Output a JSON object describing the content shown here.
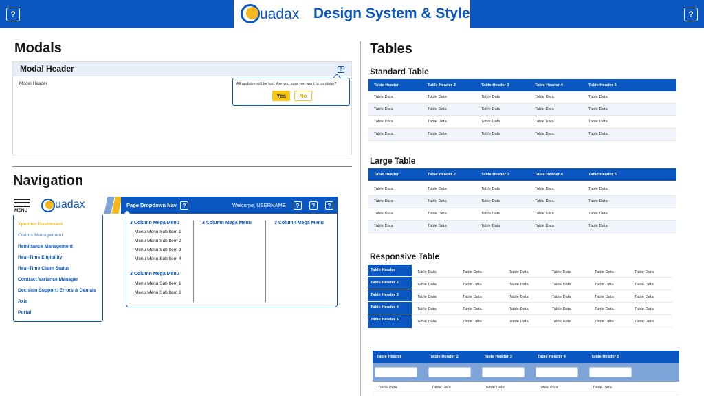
{
  "header": {
    "title": "Design System & Styles",
    "logo_text": "uadax",
    "help_glyph": "?",
    "colors": {
      "primary": "#0a57c2",
      "accent": "#f5b81c",
      "light_accent": "#7ea3d6"
    }
  },
  "modals": {
    "heading": "Modals",
    "modal_header": "Modal Header",
    "modal_body": "Modal Header",
    "help_glyph": "?",
    "popover_text": "All updates will be lost. Are you sure you want to continue?",
    "yes_label": "Yes",
    "no_label": "No"
  },
  "navigation": {
    "heading": "Navigation",
    "menu_label": "MENU",
    "logo_text": "uadax",
    "side_items": [
      "Xpeditor Dashboard",
      "Claims Management",
      "Remittance Management",
      "Real-Time Eligibility",
      "Real-Time Claim Status",
      "Contract Variance Manager",
      "Decision Support: Errors & Denials",
      "Axis",
      "Portal"
    ],
    "page_nav_title": "Page Dropdown Nav",
    "welcome": "Welcome, USERNAME",
    "help_glyph": "?",
    "mega": {
      "col1_head": "3 Column Mega Menu",
      "col1_items": [
        "Menu Menu Sub Item 1",
        "Menu Menu Sub Item 2",
        "Menu Menu Sub Item 3",
        "Menu Menu Sub Item 4"
      ],
      "col1b_head": "3 Column Mega Menu",
      "col1b_items": [
        "Menu Menu Sub Item 1",
        "Menu Menu Sub Item 2"
      ],
      "col2_head": "3 Column Mega Menu",
      "col3_head": "3 Column Mega Menu"
    }
  },
  "tables": {
    "heading": "Tables",
    "standard_title": "Standard Table",
    "large_title": "Large Table",
    "responsive_title": "Responsive Table",
    "headers": [
      "Table Header",
      "Table Header 2",
      "Table Header 3",
      "Table Header 4",
      "Table Header 5"
    ],
    "cell": "Table Data",
    "responsive_headers": [
      "Table Header",
      "Table Header 2",
      "Table Header 3",
      "Table Header 4",
      "Table Header 5"
    ]
  }
}
